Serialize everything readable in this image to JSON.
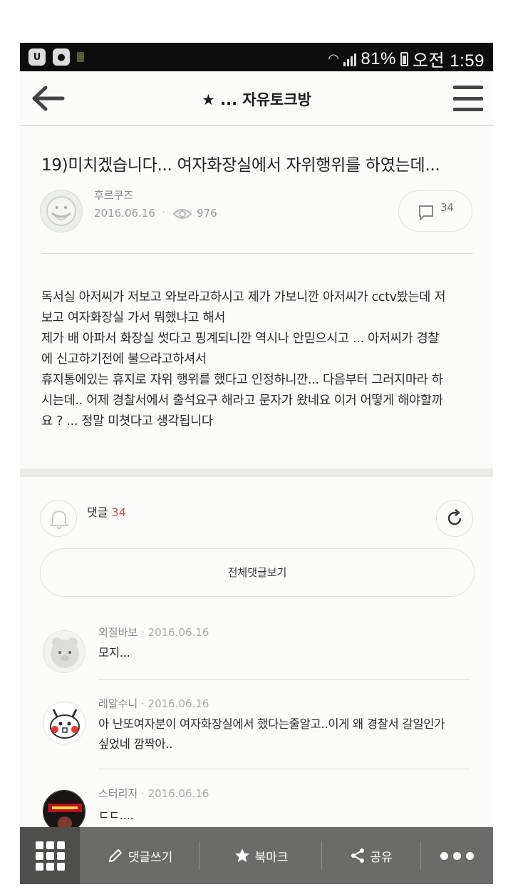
{
  "status_bar": {
    "battery": "81%",
    "time": "오전 1:59"
  },
  "header": {
    "title": "★ ... 자유토크방",
    "back_icon": "arrow-left-icon",
    "menu_icon": "hamburger-menu-icon"
  },
  "post": {
    "title": "19)미치겠습니다... 여자화장실에서 자위행위를 하였는데...",
    "author": "후르쿠즈",
    "date": "2016.06.16",
    "views": "976",
    "comment_count": "34",
    "body": [
      "독서실 아저씨가 저보고 와보라고하시고 제가 가보니깐 아저씨가 cctv봤는데 저",
      "보고 여자화장실 가서 뭐했냐고 해서",
      "제가 배 아파서 화장실 썻다고 핑계되니깐 역시나 안믿으시고 ... 아저씨가 경찰",
      "에 신고하기전에 불으라고하셔서",
      "휴지통에있는 휴지로 자위 행위를 했다고 인정하니깐... 다음부터 그러지마라 하",
      "시는데.. 어제 경찰서에서 출석요구 해라고 문자가 왔네요 이거 어떻게 해야할까",
      "요 ? ... 정말 미쳣다고 생각됩니다"
    ]
  },
  "comments_section": {
    "label": "댓글",
    "count": "34",
    "view_all": "전체댓글보기"
  },
  "comments": [
    {
      "name": "외질바보",
      "date": "2016.06.16",
      "lines": [
        "모지..."
      ]
    },
    {
      "name": "레알수니",
      "date": "2016.06.16",
      "lines": [
        "아 난또여자분이 여자화장실에서 했다는줄알고..이게 왜 경찰서 갈일인가",
        "싶었네 깜짝아.."
      ]
    },
    {
      "name": "스터리지",
      "date": "2016.06.16",
      "lines": [
        "ㄷㄷ...."
      ]
    }
  ],
  "toolbar": {
    "write_comment": "댓글쓰기",
    "bookmark": "북마크",
    "share": "공유"
  },
  "colors": {
    "accent_count": "#c0504d",
    "toolbar_bg": "#6b6b69",
    "status_bar_bg": "#0d0d0d"
  }
}
